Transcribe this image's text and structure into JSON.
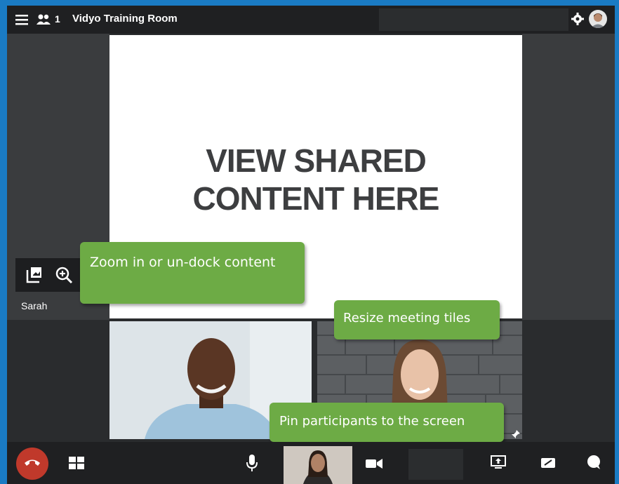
{
  "window": {
    "title": "Vidyo Training Room",
    "participant_count": "1"
  },
  "slide": {
    "line1": "VIEW SHARED",
    "line2": "CONTENT HERE"
  },
  "participants": {
    "sarah_label": "Sarah"
  },
  "tooltips": {
    "zoom": "Zoom in or un-dock content",
    "resize": "Resize meeting tiles",
    "pin": "Pin participants to the screen"
  },
  "colors": {
    "background": "#1a7bc4",
    "tooltip_green": "#6dab45",
    "end_call_red": "#c0392b",
    "bar_dark": "#1f2022"
  },
  "icons": {
    "menu": "hamburger-menu-icon",
    "participants": "participants-icon",
    "settings": "gear-icon",
    "undock": "undock-content-icon",
    "zoom": "zoom-in-icon",
    "end_call": "phone-hangup-icon",
    "layout": "layout-grid-icon",
    "mic": "microphone-icon",
    "camera": "camera-icon",
    "share": "screen-share-icon",
    "chat": "chat-icon"
  }
}
